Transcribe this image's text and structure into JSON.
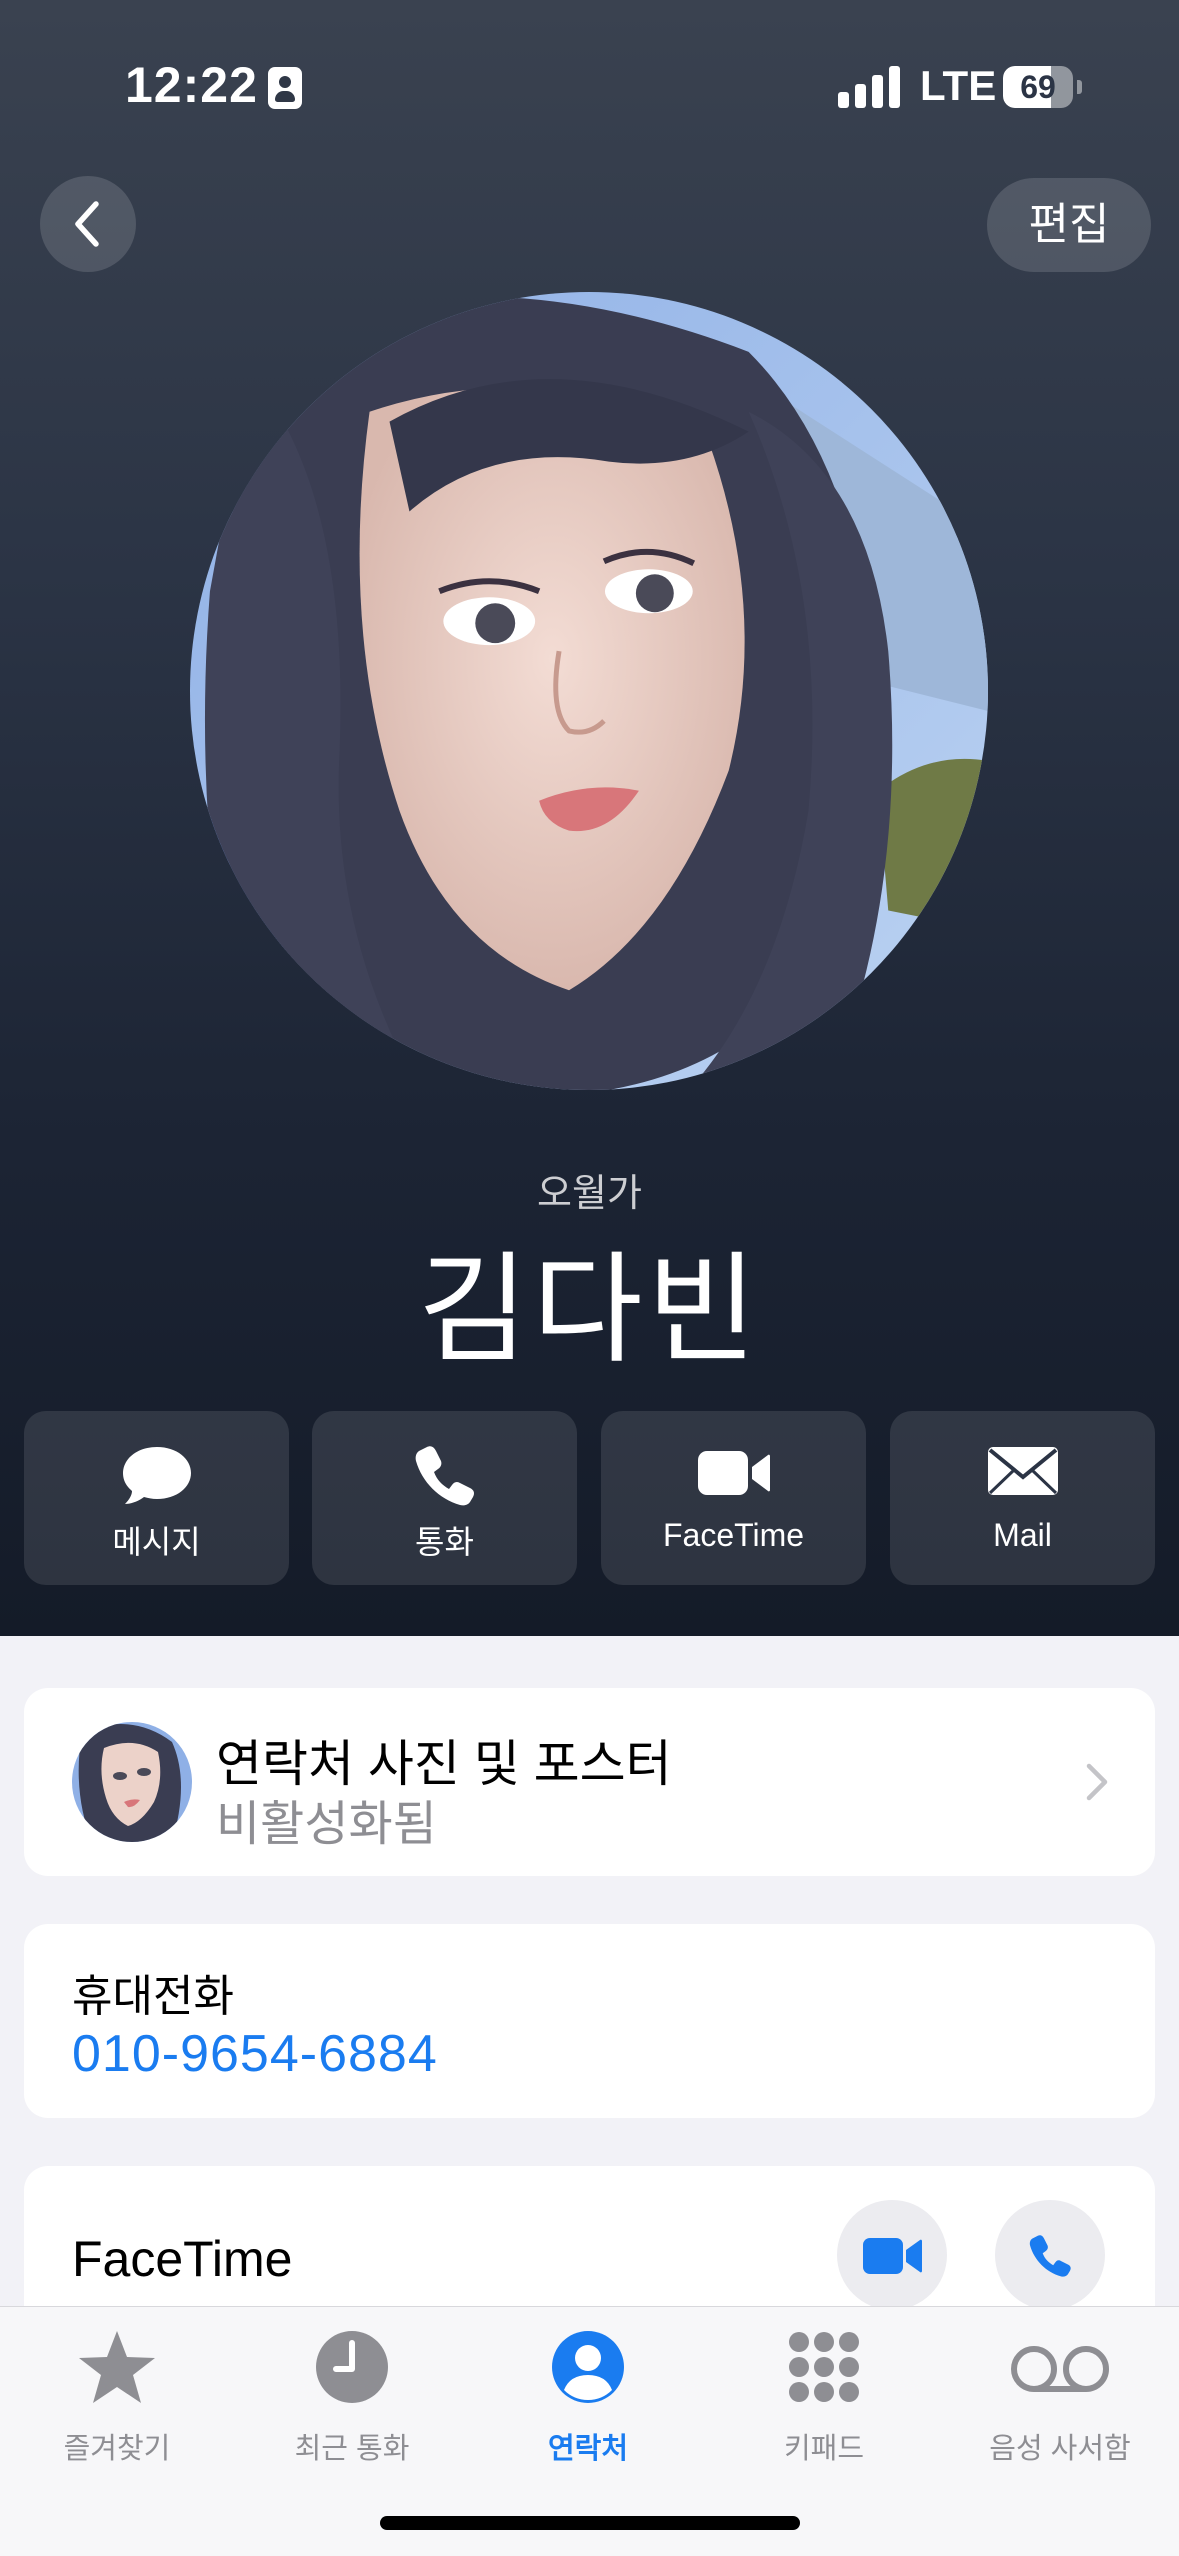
{
  "status_bar": {
    "time": "12:22",
    "network": "LTE",
    "battery_level": "69",
    "battery_fraction": 0.69
  },
  "header": {
    "back_icon": "chevron-left-icon",
    "edit_label": "편집"
  },
  "contact": {
    "subtitle": "오월가",
    "name": "김다빈"
  },
  "actions": [
    {
      "label": "메시지",
      "icon": "message-bubble-icon"
    },
    {
      "label": "통화",
      "icon": "phone-icon"
    },
    {
      "label": "FaceTime",
      "icon": "video-camera-icon"
    },
    {
      "label": "Mail",
      "icon": "envelope-icon"
    }
  ],
  "poster": {
    "title": "연락처 사진 및 포스터",
    "status": "비활성화됨"
  },
  "phone": {
    "label": "휴대전화",
    "number": "010-9654-6884"
  },
  "facetime": {
    "label": "FaceTime"
  },
  "tabs": [
    {
      "label": "즐겨찾기",
      "icon": "star-icon",
      "active": false
    },
    {
      "label": "최근 통화",
      "icon": "clock-icon",
      "active": false
    },
    {
      "label": "연락처",
      "icon": "person-circle-icon",
      "active": true
    },
    {
      "label": "키패드",
      "icon": "keypad-icon",
      "active": false
    },
    {
      "label": "음성 사서함",
      "icon": "voicemail-icon",
      "active": false
    }
  ],
  "colors": {
    "accent": "#1a7cf0",
    "hero_top": "#3a4250",
    "hero_bottom": "#141b28",
    "inactive_tab": "#8e8e93"
  }
}
